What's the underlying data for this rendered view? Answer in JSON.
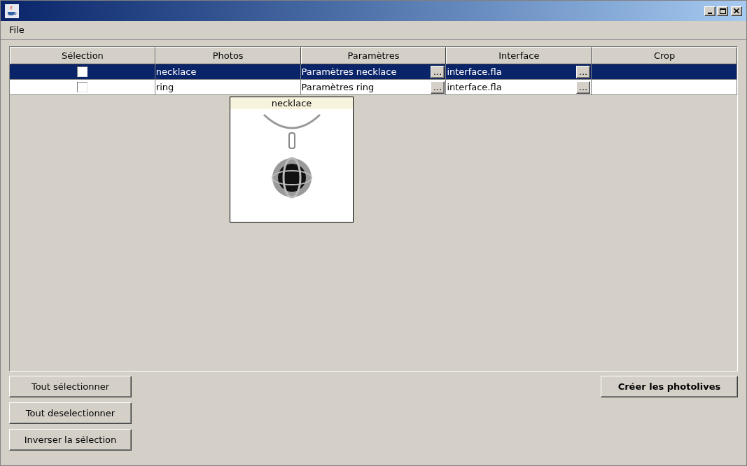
{
  "menu": [
    "File"
  ],
  "table": {
    "columns": [
      "Sélection",
      "Photos",
      "Paramètres",
      "Interface",
      "Crop"
    ],
    "rows": [
      {
        "selected": true,
        "checked": false,
        "photo": "necklace",
        "parameters": "Paramètres necklace",
        "parameters_button": "...",
        "interface": "interface.fla",
        "interface_button": "..."
      },
      {
        "selected": false,
        "checked": false,
        "photo": "ring",
        "parameters": "Paramètres ring",
        "parameters_button": "...",
        "interface": "interface.fla",
        "interface_button": "..."
      }
    ]
  },
  "tooltip": {
    "title": "necklace"
  },
  "selection_buttons": [
    "Tout sélectionner",
    "Tout deselectionner",
    "Inverser la sélection"
  ],
  "action_button": "Créer les photolives"
}
